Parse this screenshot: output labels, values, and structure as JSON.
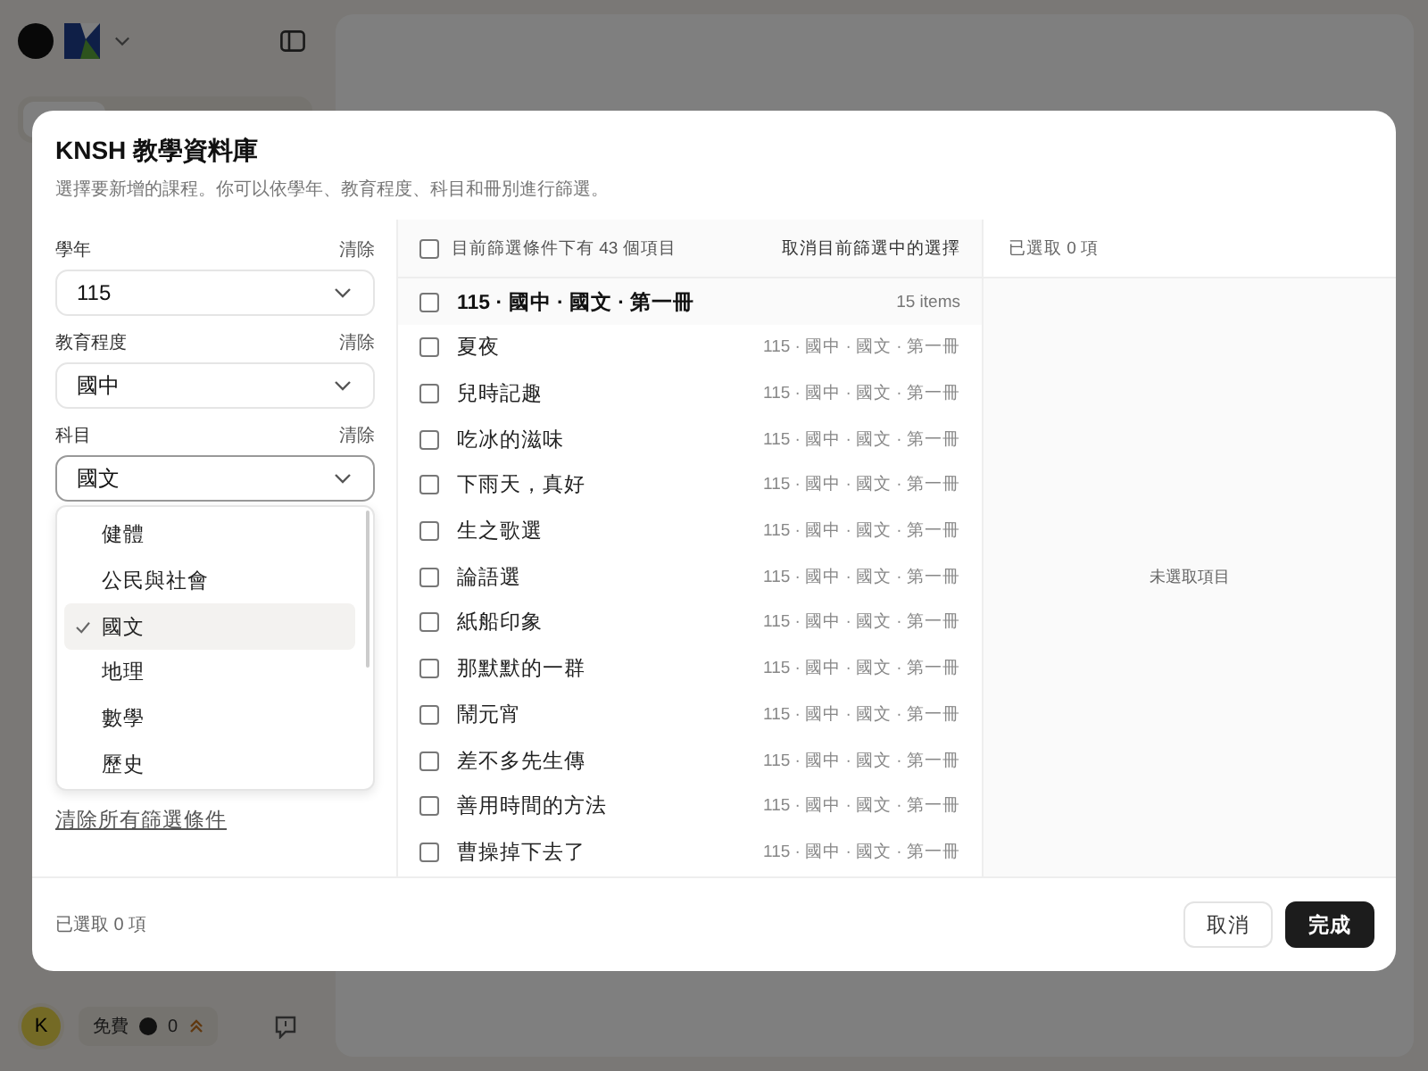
{
  "app": {
    "avatar": "K",
    "plan": "免費",
    "credits": "0"
  },
  "dialog": {
    "title": "KNSH 教學資料庫",
    "subtitle": "選擇要新增的課程。你可以依學年、教育程度、科目和冊別進行篩選。",
    "filters": [
      {
        "label": "學年",
        "clear": "清除",
        "value": "115",
        "open": false
      },
      {
        "label": "教育程度",
        "clear": "清除",
        "value": "國中",
        "open": false
      },
      {
        "label": "科目",
        "clear": "清除",
        "value": "國文",
        "open": true
      }
    ],
    "dropdown": {
      "options": [
        {
          "label": "健體",
          "selected": false
        },
        {
          "label": "公民與社會",
          "selected": false
        },
        {
          "label": "國文",
          "selected": true
        },
        {
          "label": "地理",
          "selected": false
        },
        {
          "label": "數學",
          "selected": false
        },
        {
          "label": "歷史",
          "selected": false
        }
      ]
    },
    "clear_all": "清除所有篩選條件",
    "list_header": {
      "checked": false,
      "count_text": "目前篩選條件下有 43 個項目",
      "deselect": "取消目前篩選中的選擇"
    },
    "groups": [
      {
        "title": "115 · 國中 · 國文 · 第一冊",
        "count": "15 items",
        "checked": false,
        "items": [
          {
            "title": "夏夜",
            "meta": "115 · 國中 · 國文 · 第一冊",
            "checked": false
          },
          {
            "title": "兒時記趣",
            "meta": "115 · 國中 · 國文 · 第一冊",
            "checked": false
          },
          {
            "title": "吃冰的滋味",
            "meta": "115 · 國中 · 國文 · 第一冊",
            "checked": false
          },
          {
            "title": "下雨天，真好",
            "meta": "115 · 國中 · 國文 · 第一冊",
            "checked": false
          },
          {
            "title": "生之歌選",
            "meta": "115 · 國中 · 國文 · 第一冊",
            "checked": false
          },
          {
            "title": "論語選",
            "meta": "115 · 國中 · 國文 · 第一冊",
            "checked": false
          },
          {
            "title": "紙船印象",
            "meta": "115 · 國中 · 國文 · 第一冊",
            "checked": false
          },
          {
            "title": "那默默的一群",
            "meta": "115 · 國中 · 國文 · 第一冊",
            "checked": false
          },
          {
            "title": "鬧元宵",
            "meta": "115 · 國中 · 國文 · 第一冊",
            "checked": false
          },
          {
            "title": "差不多先生傳",
            "meta": "115 · 國中 · 國文 · 第一冊",
            "checked": false
          },
          {
            "title": "善用時間的方法",
            "meta": "115 · 國中 · 國文 · 第一冊",
            "checked": false
          },
          {
            "title": "曹操掉下去了",
            "meta": "115 · 國中 · 國文 · 第一冊",
            "checked": false
          }
        ]
      }
    ],
    "selected_header": "已選取 0 項",
    "empty_text": "未選取項目",
    "footer_count": "已選取 0 項",
    "buttons": [
      {
        "label": "取消",
        "kind": "secondary"
      },
      {
        "label": "完成",
        "kind": "primary"
      }
    ]
  }
}
